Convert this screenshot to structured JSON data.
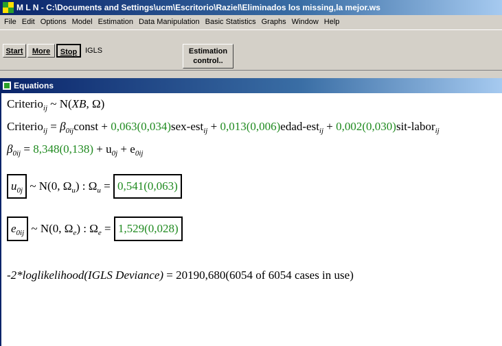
{
  "window": {
    "title": "M L N  -  C:\\Documents and Settings\\ucm\\Escritorio\\Raziel\\Eliminados los missing,la mejor.ws"
  },
  "menu": [
    "File",
    "Edit",
    "Options",
    "Model",
    "Estimation",
    "Data Manipulation",
    "Basic Statistics",
    "Graphs",
    "Window",
    "Help"
  ],
  "toolbar": {
    "start_label": "Start",
    "more_label": "More",
    "stop_label": "Stop",
    "method": "IGLS",
    "estimation_control_line1": "Estimation",
    "estimation_control_line2": "control.."
  },
  "equations_window": {
    "title": "Equations",
    "lines": {
      "dist_lhs": "Criterio",
      "dist_sub": "ij",
      "dist_rhs_prefix": " ~ N(",
      "dist_rhs_mean": "XB",
      "dist_rhs_suffix": ", Ω)",
      "model_lhs": "Criterio",
      "model_lhs_sub": "ij",
      "model_eq": " = ",
      "beta0": "β",
      "beta0_sub": "0ij",
      "const": "const + ",
      "coef1": "0,063(0,034)",
      "var1": "sex-est",
      "var1_sub": "ij",
      "plus1": " + ",
      "coef2": "0,013(0,006)",
      "var2": "edad-est",
      "var2_sub": "ij",
      "plus2": " + ",
      "coef3": "0,002(0,030)",
      "var3": "sit-labor",
      "var3_sub": "ij",
      "beta_line_lhs": "β",
      "beta_line_lhs_sub": "0ij",
      "beta_line_eq": " = ",
      "beta_value": "8,348(0,138)",
      "beta_plus_u": " + u",
      "beta_u_sub": "0j",
      "beta_plus_e": " + e",
      "beta_e_sub": "0ij",
      "u_symbol": "u",
      "u_sub": "0j",
      "u_dist": " ~ N(0,  Ω",
      "u_dist_sub": "u",
      "u_dist_end": ")  :  Ω",
      "u_omega_sub": "u",
      "u_omega_eq": " = ",
      "u_value": "0,541(0,063)",
      "e_symbol": "e",
      "e_sub": "0ij",
      "e_dist": " ~ N(0,  Ω",
      "e_dist_sub": "e",
      "e_dist_end": ")  :  Ω",
      "e_omega_sub": "e",
      "e_omega_eq": " = ",
      "e_value": "1,529(0,028)",
      "loglik_prefix": "-2*",
      "loglik_ital": "loglikelihood(IGLS Deviance)",
      "loglik_rest": " = 20190,680(6054 of 6054 cases in use)"
    }
  },
  "colors": {
    "estimate_green": "#1f8a1f",
    "titlebar_blue": "#0a246a"
  }
}
